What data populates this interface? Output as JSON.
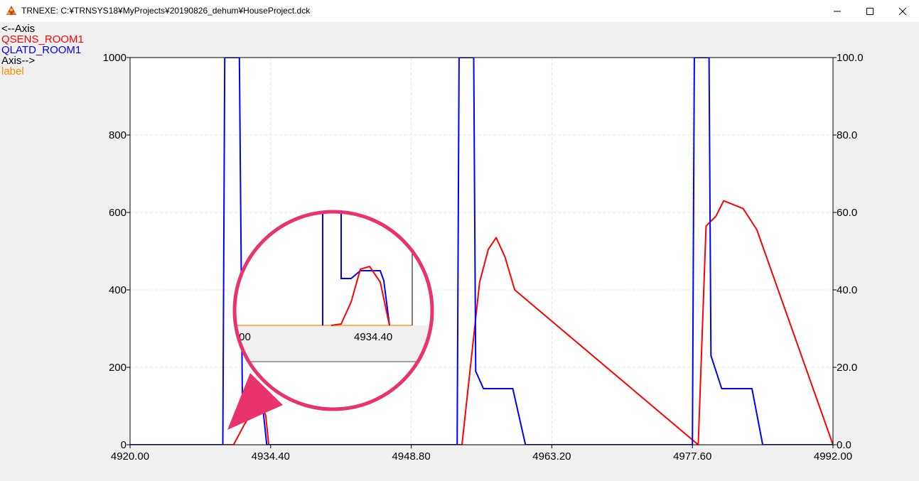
{
  "window": {
    "title": "TRNEXE: C:¥TRNSYS18¥MyProjects¥20190826_dehum¥HouseProject.dck",
    "icon": "trnsys-logo-icon"
  },
  "legend": {
    "left_axis_label": "<--Axis",
    "series_left": [
      {
        "name": "QSENS_ROOM1",
        "color": "#ff0000"
      },
      {
        "name": "QLATD_ROOM1",
        "color": "#0000ff"
      }
    ],
    "right_axis_label": "Axis-->",
    "series_right": [
      {
        "name": "label",
        "color": "#ff8c00"
      }
    ]
  },
  "chart_data": {
    "type": "line",
    "xlim": [
      4920.0,
      4992.0
    ],
    "ylim_left": [
      0,
      1000
    ],
    "ylim_right": [
      0.0,
      100.0
    ],
    "x_ticks": [
      "4920.00",
      "4934.40",
      "4948.80",
      "4963.20",
      "4977.60",
      "4992.00"
    ],
    "x_tick_values": [
      4920.0,
      4934.4,
      4948.8,
      4963.2,
      4977.6,
      4992.0
    ],
    "y_left_ticks": [
      "0",
      "200",
      "400",
      "600",
      "800",
      "1000"
    ],
    "y_left_tick_values": [
      0,
      200,
      400,
      600,
      800,
      1000
    ],
    "y_right_ticks": [
      "0.0",
      "20.0",
      "40.0",
      "60.0",
      "80.0",
      "100.0"
    ],
    "y_right_tick_values": [
      0,
      20,
      40,
      60,
      80,
      100
    ],
    "grid": true,
    "series": [
      {
        "name": "QSENS_ROOM1",
        "color": "#ff0000",
        "axis": "left",
        "x": [
          4920,
          4930.2,
          4930.6,
          4931.7,
          4932.9,
          4933.2,
          4933.5,
          4933.9,
          4934.2,
          4954.0,
          4955.8,
          4956.7,
          4957.5,
          4958.4,
          4959.4,
          4978.2,
          4979.0,
          4980.0,
          4980.8,
          4982.8,
          4984.2,
          4992
        ],
        "y": [
          0,
          0,
          0,
          52,
          100,
          110,
          105,
          75,
          0,
          0,
          420,
          505,
          535,
          485,
          400,
          0,
          565,
          590,
          630,
          610,
          555,
          0
        ]
      },
      {
        "name": "QLATD_ROOM1",
        "color": "#0000ff",
        "axis": "left",
        "x": [
          4920,
          4929.5,
          4929.7,
          4929.7,
          4931.2,
          4931.2,
          4931.5,
          4931.5,
          4932.4,
          4932.7,
          4933.5,
          4934.0,
          4934.4,
          4953.5,
          4953.7,
          4953.7,
          4955.2,
          4955.2,
          4955.4,
          4955.4,
          4956.2,
          4959.2,
          4960.5,
          4977.6,
          4977.8,
          4977.8,
          4979.3,
          4979.3,
          4979.5,
          4979.5,
          4980.6,
          4983.7,
          4984.8,
          4992
        ],
        "y": [
          0,
          0,
          1000,
          1000,
          1000,
          1000,
          120,
          120,
          120,
          120,
          120,
          0,
          0,
          0,
          1000,
          1000,
          1000,
          1000,
          190,
          190,
          145,
          145,
          0,
          0,
          1000,
          1000,
          1000,
          1000,
          230,
          230,
          145,
          145,
          0,
          0
        ]
      },
      {
        "name": "label",
        "color": "#ff8c00",
        "axis": "right",
        "x": [
          4920,
          4992
        ],
        "y": [
          0,
          0
        ]
      }
    ],
    "magnifier": {
      "x_tick": "4934.40",
      "partial_tick": ".00"
    }
  }
}
